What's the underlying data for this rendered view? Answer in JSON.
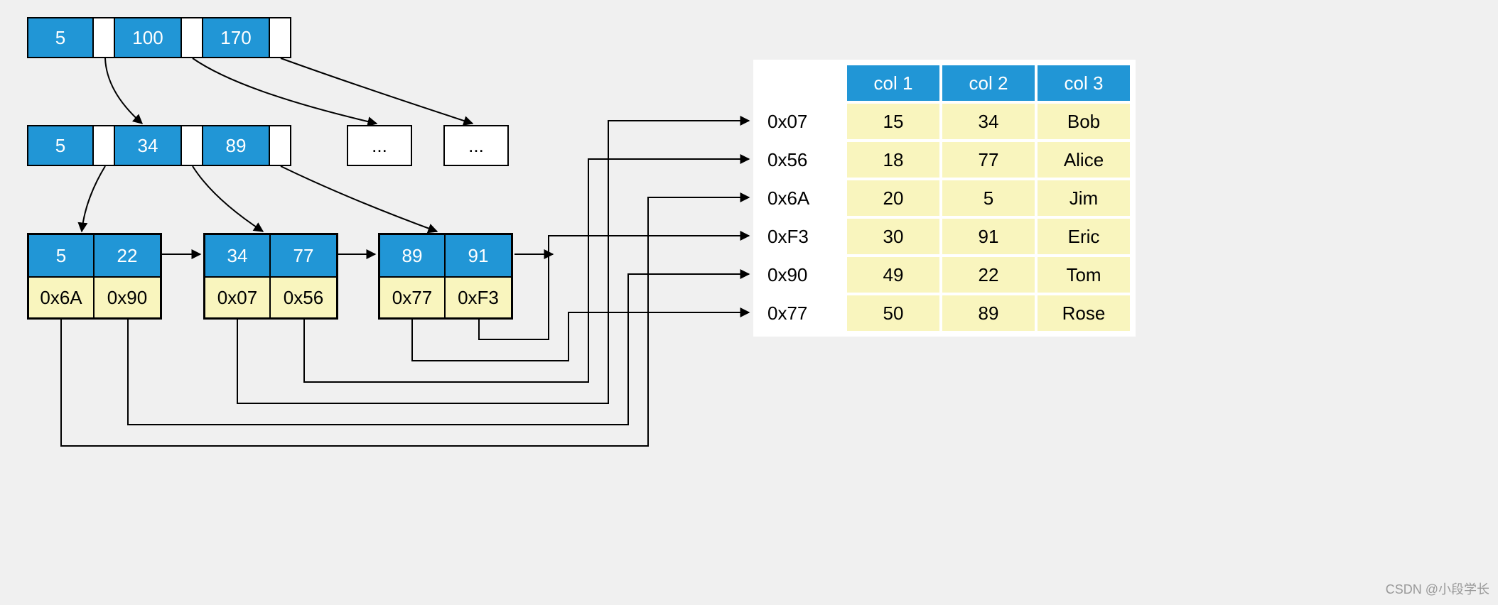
{
  "root": {
    "keys": [
      "5",
      "100",
      "170"
    ]
  },
  "level2": {
    "node1": {
      "keys": [
        "5",
        "34",
        "89"
      ]
    },
    "ellipsis1": "...",
    "ellipsis2": "..."
  },
  "leaves": [
    {
      "keys": [
        "5",
        "22"
      ],
      "ptrs": [
        "0x6A",
        "0x90"
      ]
    },
    {
      "keys": [
        "34",
        "77"
      ],
      "ptrs": [
        "0x07",
        "0x56"
      ]
    },
    {
      "keys": [
        "89",
        "91"
      ],
      "ptrs": [
        "0x77",
        "0xF3"
      ]
    }
  ],
  "table": {
    "headers": [
      "col 1",
      "col 2",
      "col 3"
    ],
    "rows": [
      {
        "addr": "0x07",
        "c1": "15",
        "c2": "34",
        "c3": "Bob"
      },
      {
        "addr": "0x56",
        "c1": "18",
        "c2": "77",
        "c3": "Alice"
      },
      {
        "addr": "0x6A",
        "c1": "20",
        "c2": "5",
        "c3": "Jim"
      },
      {
        "addr": "0xF3",
        "c1": "30",
        "c2": "91",
        "c3": "Eric"
      },
      {
        "addr": "0x90",
        "c1": "49",
        "c2": "22",
        "c3": "Tom"
      },
      {
        "addr": "0x77",
        "c1": "50",
        "c2": "89",
        "c3": "Rose"
      }
    ]
  },
  "watermark": "CSDN @小段学长"
}
